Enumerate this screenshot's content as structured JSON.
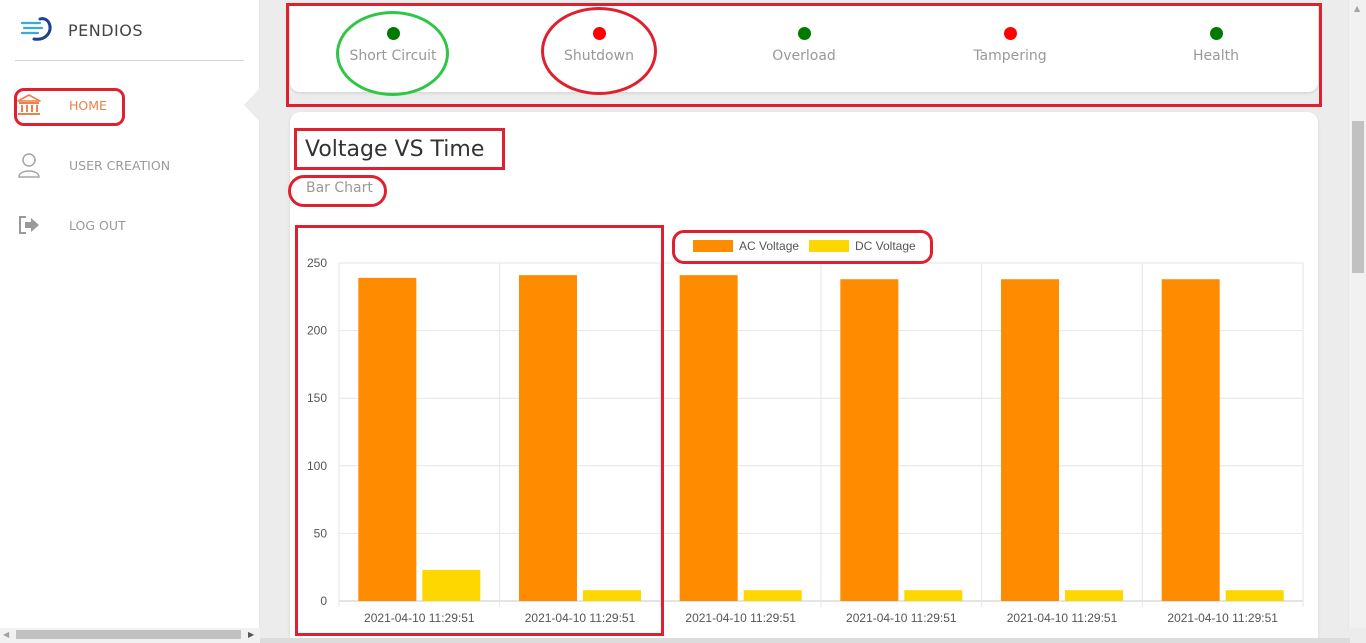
{
  "brand": {
    "name": "PENDIOS",
    "logo_icon": "pendios-logo-icon"
  },
  "sidebar": {
    "items": [
      {
        "label": "HOME",
        "icon": "bank-icon",
        "active": true
      },
      {
        "label": "USER CREATION",
        "icon": "user-icon",
        "active": false
      },
      {
        "label": "LOG OUT",
        "icon": "logout-icon",
        "active": false
      }
    ],
    "active_color": "#f07f4a"
  },
  "status": {
    "items": [
      {
        "label": "Short Circuit",
        "color": "#007a00"
      },
      {
        "label": "Shutdown",
        "color": "#ff0000"
      },
      {
        "label": "Overload",
        "color": "#007a00"
      },
      {
        "label": "Tampering",
        "color": "#ff0000"
      },
      {
        "label": "Health",
        "color": "#007a00"
      }
    ]
  },
  "chart_section": {
    "title": "Voltage VS Time",
    "subtitle": "Bar Chart"
  },
  "chart_data": {
    "type": "bar",
    "categories": [
      "2021-04-10 11:29:51",
      "2021-04-10 11:29:51",
      "2021-04-10 11:29:51",
      "2021-04-10 11:29:51",
      "2021-04-10 11:29:51",
      "2021-04-10 11:29:51"
    ],
    "series": [
      {
        "name": "AC Voltage",
        "color": "#ff8c00",
        "values": [
          239,
          241,
          241,
          238,
          238,
          238
        ]
      },
      {
        "name": "DC Voltage",
        "color": "#ffd700",
        "values": [
          23,
          8,
          8,
          8,
          8,
          8
        ]
      }
    ],
    "ylim": [
      0,
      250
    ],
    "yticks": [
      "0",
      "50",
      "100",
      "150",
      "200",
      "250"
    ],
    "grid": true,
    "legend": "top-center"
  },
  "annotation_colors": {
    "primary": "#e0202e",
    "secondary": "#2fc646"
  }
}
